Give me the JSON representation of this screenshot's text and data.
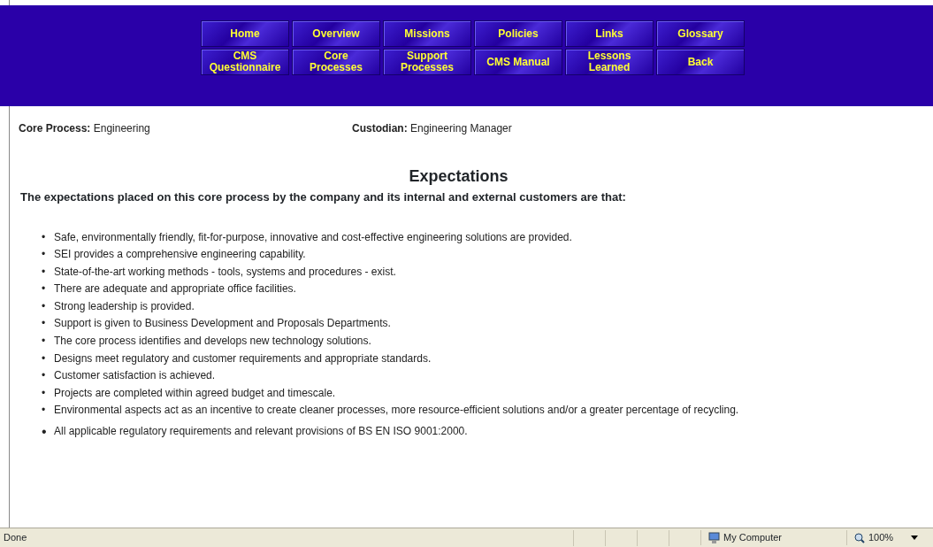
{
  "nav_rows": [
    [
      "Home",
      "Overview",
      "Missions",
      "Policies",
      "Links",
      "Glossary"
    ],
    [
      "CMS Questionnaire",
      "Core Processes",
      "Support Processes",
      "CMS Manual",
      "Lessons Learned",
      "Back"
    ]
  ],
  "info": [
    "**Core Process:** Engineering",
    "**Custodian:** Engineering Manager"
  ],
  "heading": "Expectations",
  "intro": "The expectations placed on this core process by the company and its internal and external customers are that:",
  "bullet": "•",
  "items": [
    "Safe, environmentally friendly, fit-for-purpose, innovative and cost-effective engineering solutions are provided.",
    "SEI provides a comprehensive engineering capability.",
    "State-of-the-art working methods - tools, systems and procedures - exist.",
    "There are adequate and appropriate office facilities.",
    "Strong leadership is provided.",
    "Support is given to Business Development and Proposals Departments.",
    "The core process identifies and develops new technology solutions.",
    "Designs meet regulatory and customer requirements and appropriate standards.",
    "Customer satisfaction is achieved.",
    "Projects are completed within agreed budget and timescale.",
    "Environmental aspects act as an incentive to create cleaner processes, more resource-efficient solutions and/or a greater percentage of recycling.",
    "All applicable regulatory requirements and relevant provisions of BS EN ISO 9001:2000."
  ],
  "status_bar": {
    "text": "Done",
    "zone": "My Computer",
    "zoom": "100%"
  }
}
